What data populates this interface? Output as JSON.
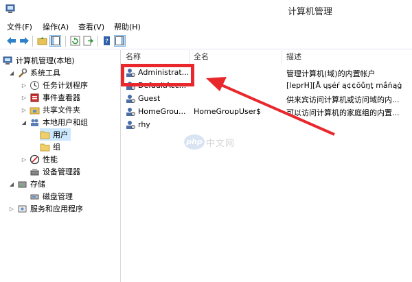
{
  "window": {
    "title": "计算机管理"
  },
  "menu": [
    {
      "label": "文件(F)"
    },
    {
      "label": "操作(A)"
    },
    {
      "label": "查看(V)"
    },
    {
      "label": "帮助(H)"
    }
  ],
  "tree": [
    {
      "label": "计算机管理(本地)",
      "icon": "computer-management-icon"
    },
    {
      "label": "系统工具",
      "icon": "tools-icon"
    },
    {
      "label": "任务计划程序",
      "icon": "clock-icon"
    },
    {
      "label": "事件查看器",
      "icon": "event-viewer-icon"
    },
    {
      "label": "共享文件夹",
      "icon": "shared-folder-icon"
    },
    {
      "label": "本地用户和组",
      "icon": "users-group-icon"
    },
    {
      "label": "用户",
      "icon": "folder-icon"
    },
    {
      "label": "组",
      "icon": "folder-icon"
    },
    {
      "label": "性能",
      "icon": "performance-icon"
    },
    {
      "label": "设备管理器",
      "icon": "device-manager-icon"
    },
    {
      "label": "存储",
      "icon": "storage-icon"
    },
    {
      "label": "磁盘管理",
      "icon": "disk-icon"
    },
    {
      "label": "服务和应用程序",
      "icon": "services-icon"
    }
  ],
  "columns": {
    "name": "名称",
    "fullname": "全名",
    "description": "描述"
  },
  "users": [
    {
      "name": "Administrat...",
      "fullname": "",
      "description": "管理计算机(域)的内置帐户"
    },
    {
      "name": "DefaultAcc...",
      "fullname": "",
      "description": "[leprH][Å ųşéŕ ą¢¢ŏůŋţ mắńąġ"
    },
    {
      "name": "Guest",
      "fullname": "",
      "description": "供来宾访问计算机或访问域的内..."
    },
    {
      "name": "HomeGrou...",
      "fullname": "HomeGroupUser$",
      "description": "可以访问计算机的家庭组的内置..."
    },
    {
      "name": "rhy",
      "fullname": "",
      "description": ""
    }
  ],
  "watermark": {
    "logo": "php",
    "text": "中文网"
  },
  "colors": {
    "highlight": "#e8282c",
    "selection": "#cce8ff"
  }
}
